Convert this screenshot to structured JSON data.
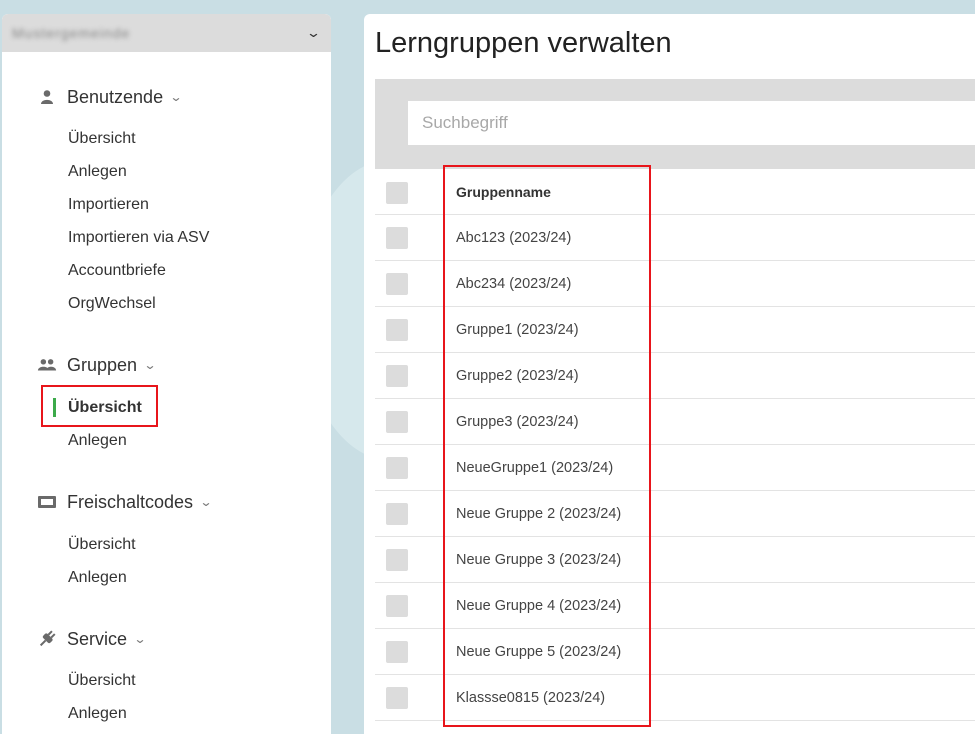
{
  "sidebar": {
    "org_name": "Mustergemeinde",
    "sections": [
      {
        "title": "Benutzende",
        "icon": "person-icon",
        "items": [
          "Übersicht",
          "Anlegen",
          "Importieren",
          "Importieren via ASV",
          "Accountbriefe",
          "OrgWechsel"
        ]
      },
      {
        "title": "Gruppen",
        "icon": "group-icon",
        "items": [
          "Übersicht",
          "Anlegen"
        ],
        "active": "Übersicht"
      },
      {
        "title": "Freischaltcodes",
        "icon": "ticket-icon",
        "items": [
          "Übersicht",
          "Anlegen"
        ]
      },
      {
        "title": "Service",
        "icon": "plug-icon",
        "items": [
          "Übersicht",
          "Anlegen"
        ]
      }
    ]
  },
  "main": {
    "title": "Lerngruppen verwalten",
    "search": {
      "placeholder": "Suchbegriff"
    },
    "table": {
      "header": "Gruppenname",
      "rows": [
        "Abc123 (2023/24)",
        "Abc234 (2023/24)",
        "Gruppe1 (2023/24)",
        "Gruppe2 (2023/24)",
        "Gruppe3 (2023/24)",
        "NeueGruppe1 (2023/24)",
        "Neue Gruppe 2 (2023/24)",
        "Neue Gruppe 3 (2023/24)",
        "Neue Gruppe 4 (2023/24)",
        "Neue Gruppe 5 (2023/24)",
        "Klassse0815 (2023/24)"
      ]
    }
  },
  "colors": {
    "highlight": "#e8151b",
    "active_indicator": "#3caa4a",
    "panel_gray": "#dcdcdc"
  }
}
